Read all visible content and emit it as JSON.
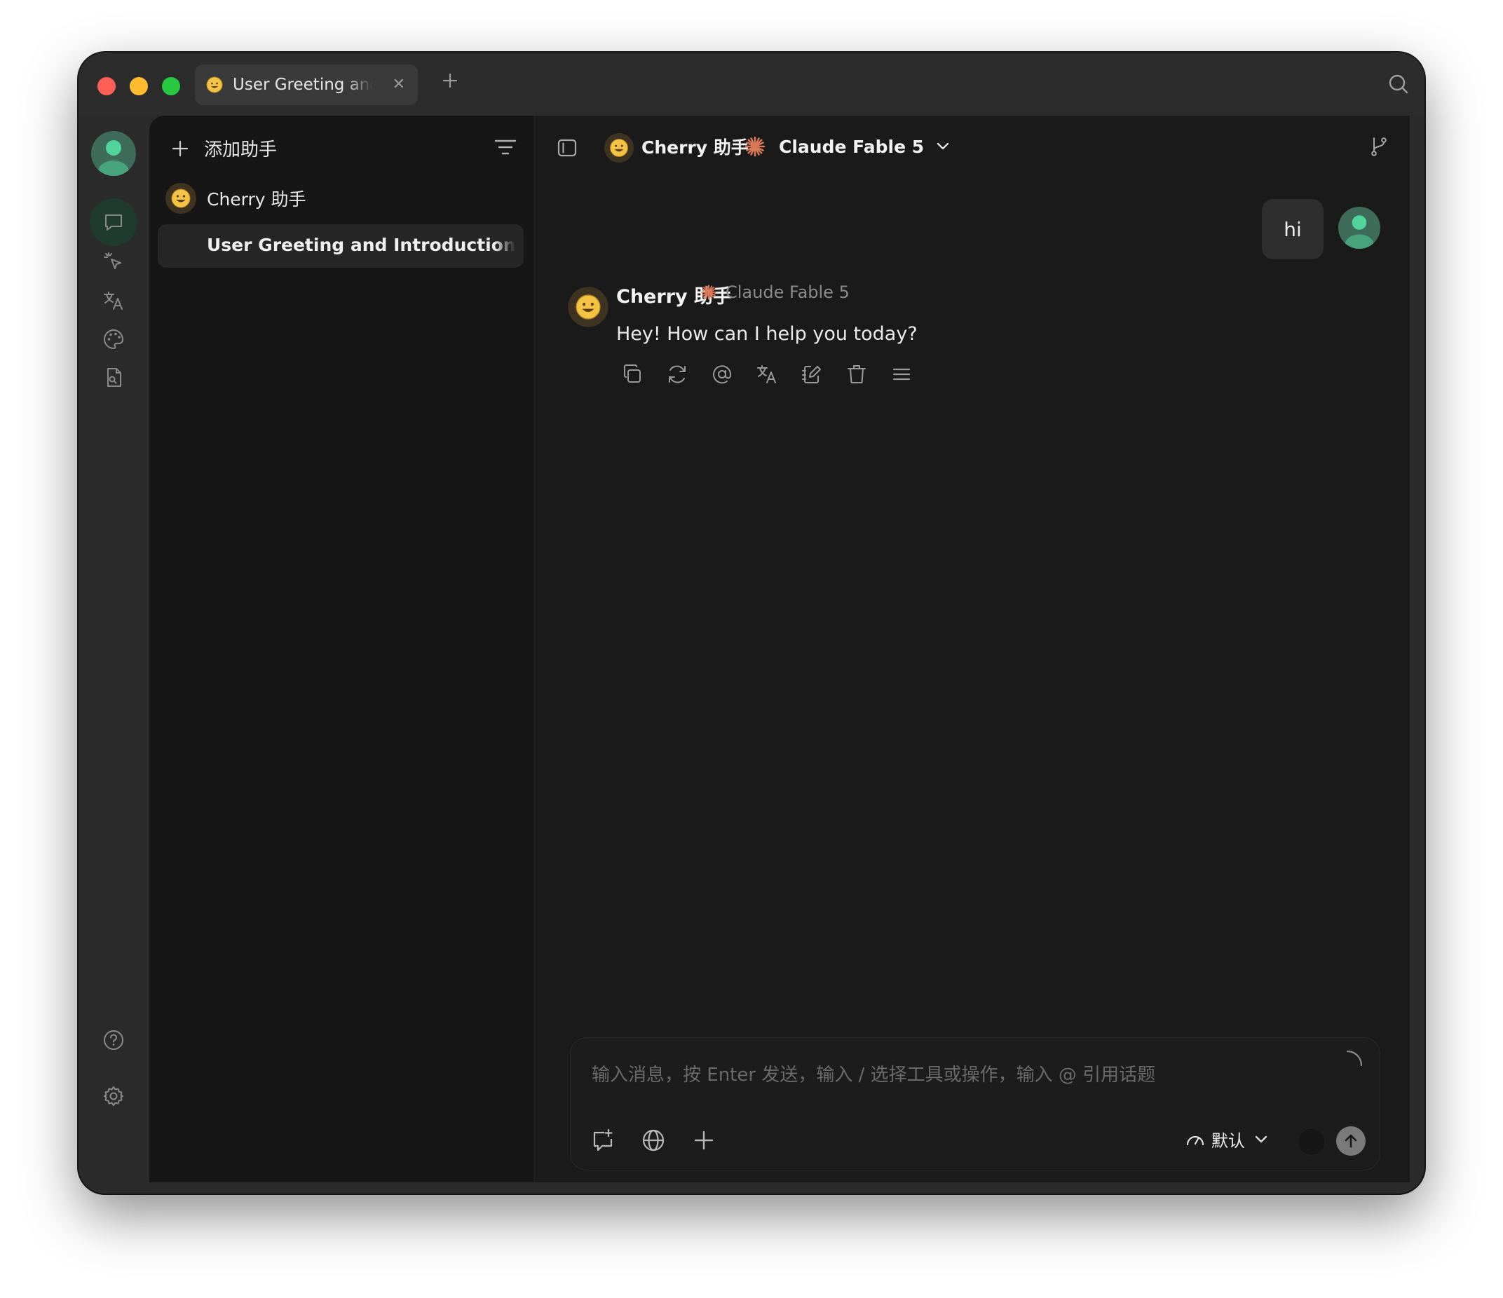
{
  "tab": {
    "title": "User Greeting and Introduction of Assistant",
    "emoji": "😀"
  },
  "sidebar": {
    "add_assistant_label": "添加助手",
    "assistant_name": "Cherry 助手",
    "topic_title": "User Greeting and Introduction of Assistant"
  },
  "header": {
    "assistant_name": "Cherry 助手",
    "model_name": "Claude Fable 5"
  },
  "messages": {
    "user_text": "hi",
    "assistant_name": "Cherry 助手",
    "assistant_model": "Claude Fable 5",
    "assistant_text": "Hey! How can I help you today?"
  },
  "input": {
    "placeholder": "输入消息，按 Enter 发送，输入 / 选择工具或操作，输入 @ 引用话题",
    "thinking_label": "默认"
  },
  "colors": {
    "accent_green": "#3e6b5a",
    "claude_orange": "#d97757",
    "active_rail": "#1f3a2e"
  },
  "icons": {
    "rail": [
      "chat-icon",
      "pointer-sparkle-icon",
      "translate-icon",
      "palette-icon",
      "file-search-icon",
      "help-icon",
      "settings-icon"
    ],
    "actions": [
      "copy-icon",
      "regenerate-icon",
      "mention-icon",
      "translate-icon",
      "edit-icon",
      "delete-icon",
      "menu-icon"
    ]
  }
}
